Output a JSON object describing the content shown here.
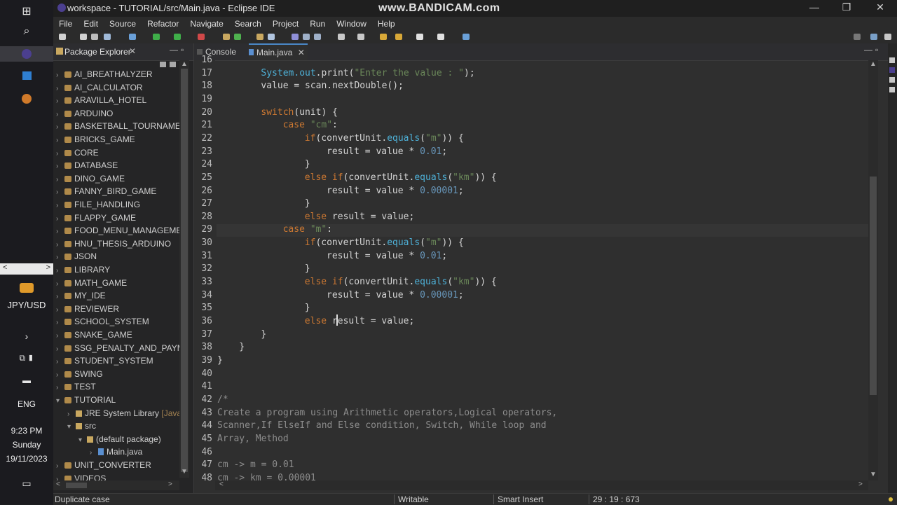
{
  "window": {
    "title": "workspace - TUTORIAL/src/Main.java - Eclipse IDE",
    "watermark": "www.BANDICAM.com"
  },
  "menu": [
    "File",
    "Edit",
    "Source",
    "Refactor",
    "Navigate",
    "Search",
    "Project",
    "Run",
    "Window",
    "Help"
  ],
  "taskbar": {
    "currency": "JPY/USD",
    "language": "ENG",
    "time": "9:23 PM",
    "day": "Sunday",
    "date": "19/11/2023"
  },
  "package_explorer": {
    "title": "Package Explorer",
    "projects": [
      {
        "label": "AI_BREATHALYZER",
        "expanded": false
      },
      {
        "label": "AI_CALCULATOR",
        "expanded": false
      },
      {
        "label": "ARAVILLA_HOTEL",
        "expanded": false
      },
      {
        "label": "ARDUINO",
        "expanded": false
      },
      {
        "label": "BASKETBALL_TOURNAMENT",
        "expanded": false
      },
      {
        "label": "BRICKS_GAME",
        "expanded": false
      },
      {
        "label": "CORE",
        "expanded": false
      },
      {
        "label": "DATABASE",
        "expanded": false
      },
      {
        "label": "DINO_GAME",
        "expanded": false
      },
      {
        "label": "FANNY_BIRD_GAME",
        "expanded": false
      },
      {
        "label": "FILE_HANDLING",
        "expanded": false
      },
      {
        "label": "FLAPPY_GAME",
        "expanded": false
      },
      {
        "label": "FOOD_MENU_MANAGEMEN",
        "expanded": false
      },
      {
        "label": "HNU_THESIS_ARDUINO",
        "expanded": false
      },
      {
        "label": "JSON",
        "expanded": false
      },
      {
        "label": "LIBRARY",
        "expanded": false
      },
      {
        "label": "MATH_GAME",
        "expanded": false
      },
      {
        "label": "MY_IDE",
        "expanded": false
      },
      {
        "label": "REVIEWER",
        "expanded": false
      },
      {
        "label": "SCHOOL_SYSTEM",
        "expanded": false
      },
      {
        "label": "SNAKE_GAME",
        "expanded": false
      },
      {
        "label": "SSG_PENALTY_AND_PAYMEN",
        "expanded": false
      },
      {
        "label": "STUDENT_SYSTEM",
        "expanded": false
      },
      {
        "label": "SWING",
        "expanded": false
      },
      {
        "label": "TEST",
        "expanded": false
      },
      {
        "label": "TUTORIAL",
        "expanded": true
      }
    ],
    "tutorial_children": {
      "jre": "JRE System Library",
      "jre_suffix": "[JavaS",
      "src": "src",
      "default_package": "(default package)",
      "main_file": "Main.java"
    },
    "after_projects": [
      "UNIT_CONVERTER",
      "VIDEOS"
    ]
  },
  "editor": {
    "tabs": [
      {
        "label": "Console",
        "active": false
      },
      {
        "label": "Main.java",
        "active": true
      }
    ],
    "line_numbers": [
      "16",
      "17",
      "18",
      "19",
      "20",
      "21",
      "22",
      "23",
      "24",
      "25",
      "26",
      "27",
      "28",
      "29",
      "30",
      "31",
      "32",
      "33",
      "34",
      "35",
      "36",
      "37",
      "38",
      "39",
      "40",
      "41",
      "42",
      "43",
      "44",
      "45",
      "46",
      "47",
      "48"
    ],
    "code": {
      "l16": "",
      "l17a": "System.",
      "l17b": "out",
      "l17c": ".print(",
      "l17d": "\"Enter the value : \"",
      "l17e": ");",
      "l18": "value = scan.nextDouble();",
      "l19": "",
      "l20a": "switch",
      "l20b": "(unit) {",
      "l21a": "case",
      "l21b": "\"cm\"",
      "l21c": ":",
      "l22a": "if",
      "l22b": "(convertUnit.",
      "l22c": "equals",
      "l22d": "(",
      "l22e": "\"m\"",
      "l22f": ")) {",
      "l23a": "result = value * ",
      "l23b": "0.01",
      "l23c": ";",
      "l24": "}",
      "l25a": "else if",
      "l25b": "(convertUnit.",
      "l25c": "equals",
      "l25d": "(",
      "l25e": "\"km\"",
      "l25f": ")) {",
      "l26a": "result = value * ",
      "l26b": "0.00001",
      "l26c": ";",
      "l27": "}",
      "l28a": "else",
      "l28b": " result = value;",
      "l29a": "case",
      "l29b": "\"m\"",
      "l29c": ":",
      "l30a": "if",
      "l30b": "(convertUnit.",
      "l30c": "equals",
      "l30d": "(",
      "l30e": "\"m\"",
      "l30f": ")) {",
      "l31a": "result = value * ",
      "l31b": "0.01",
      "l31c": ";",
      "l32": "}",
      "l33a": "else if",
      "l33b": "(convertUnit.",
      "l33c": "equals",
      "l33d": "(",
      "l33e": "\"km\"",
      "l33f": ")) {",
      "l34a": "result = value * ",
      "l34b": "0.00001",
      "l34c": ";",
      "l35": "}",
      "l36a": "else",
      "l36b": " result = value;",
      "l37": "}",
      "l38": "}",
      "l39": "}",
      "l40": "",
      "l41": "",
      "l42": "/*",
      "l43": "Create a program using Arithmetic operators,Logical operators,",
      "l44": "Scanner,If ElseIf and Else condition, Switch, While loop and",
      "l45": "Array, Method",
      "l46": "",
      "l47": "cm -> m = 0.01",
      "l48": "cm -> km = 0.00001"
    }
  },
  "status": {
    "message": "Duplicate case",
    "mode": "Writable",
    "insert": "Smart Insert",
    "position": "29 : 19 : 673"
  }
}
